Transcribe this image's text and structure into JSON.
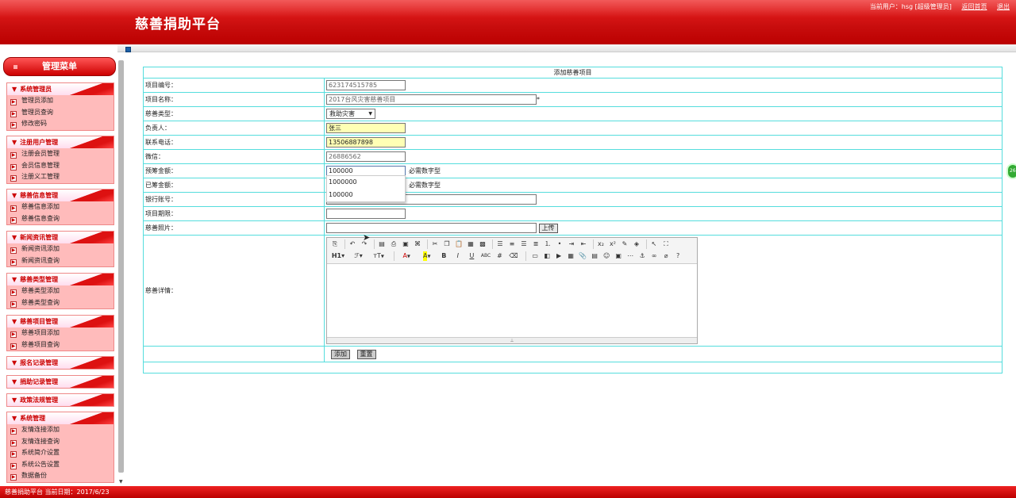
{
  "header": {
    "site_title": "慈善捐助平台",
    "user_info": "当前用户：hsg [超级管理员]",
    "home_link": "返回首页",
    "logout_link": "退出"
  },
  "sidebar": {
    "menu_title": "管理菜单",
    "groups": [
      {
        "title": "系统管理员",
        "items": [
          "管理员添加",
          "管理员查询",
          "修改密码"
        ]
      },
      {
        "title": "注册用户管理",
        "items": [
          "注册会员管理",
          "会员信息管理",
          "注册义工管理"
        ]
      },
      {
        "title": "慈善信息管理",
        "items": [
          "慈善信息添加",
          "慈善信息查询"
        ]
      },
      {
        "title": "新闻资讯管理",
        "items": [
          "新闻资讯添加",
          "新闻资讯查询"
        ]
      },
      {
        "title": "慈善类型管理",
        "items": [
          "慈善类型添加",
          "慈善类型查询"
        ]
      },
      {
        "title": "慈善项目管理",
        "items": [
          "慈善项目添加",
          "慈善项目查询"
        ]
      },
      {
        "title": "报名记录管理",
        "items": []
      },
      {
        "title": "捐助记录管理",
        "items": []
      },
      {
        "title": "政策法规管理",
        "items": []
      },
      {
        "title": "系统管理",
        "items": [
          "友情连接添加",
          "友情连接查询",
          "系统简介设置",
          "系统公告设置",
          "数据备份"
        ]
      }
    ]
  },
  "form": {
    "caption": "添加慈善项目",
    "fields": {
      "project_no": {
        "label": "项目编号：",
        "value": "623174515785"
      },
      "project_name": {
        "label": "项目名称：",
        "value": "2017台风灾害慈善项目",
        "required_mark": "*"
      },
      "charity_type": {
        "label": "慈善类型：",
        "value": "救助灾害"
      },
      "person": {
        "label": "负责人：",
        "value": "张三"
      },
      "phone": {
        "label": "联系电话：",
        "value": "13506887898"
      },
      "wechat": {
        "label": "微信：",
        "value": "26886562"
      },
      "target_amount": {
        "label": "预筹金额：",
        "value": "100000",
        "hint": "必需数字型"
      },
      "raised_amount": {
        "label": "已筹金额：",
        "hint": "必需数字型"
      },
      "bank_account": {
        "label": "银行账号：",
        "value": ""
      },
      "period": {
        "label": "项目期限：",
        "value": ""
      },
      "photo": {
        "label": "慈善照片：",
        "value": "",
        "upload_label": "上传"
      },
      "details": {
        "label": "慈善详情："
      }
    },
    "autocomplete_options": [
      "1000000",
      "100000"
    ],
    "buttons": {
      "submit": "添加",
      "reset": "重置"
    }
  },
  "editor": {
    "row1": [
      "source-icon",
      "undo-icon",
      "redo-icon",
      "template-icon",
      "print-icon",
      "preview-icon",
      "code-icon",
      "cut-icon",
      "copy-icon",
      "paste-icon",
      "paste-text-icon",
      "paste-word-icon",
      "align-left-icon",
      "align-center-icon",
      "align-right-icon",
      "justify-icon",
      "ol-icon",
      "ul-icon",
      "indent-icon",
      "outdent-icon",
      "subscript-icon",
      "superscript-icon",
      "clear-format-icon",
      "select-all-icon",
      "pointer-icon",
      "fullscreen-icon"
    ],
    "row2_labels": {
      "heading": "H1",
      "font": "ℱ",
      "size": "ᴛT",
      "forecolor": "A",
      "bold": "B",
      "italic": "I",
      "underline": "U",
      "strike": "ABC",
      "hr": "#"
    },
    "row2_icons": [
      "image-icon",
      "flash-icon",
      "media-icon",
      "table-icon",
      "attachment-icon",
      "rule-icon",
      "emoticon-icon",
      "map-icon",
      "pagebreak-icon",
      "anchor-icon",
      "link-icon",
      "unlink-icon",
      "help-icon"
    ]
  },
  "footer": {
    "status": "慈善捐助平台 当前日期：2017/6/23"
  },
  "float_bubble": {
    "text": "26"
  }
}
